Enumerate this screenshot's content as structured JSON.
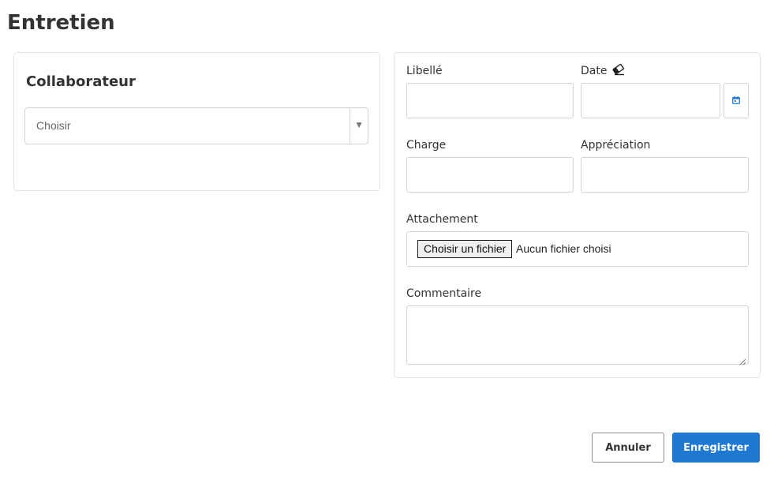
{
  "page": {
    "title": "Entretien"
  },
  "collaborateur": {
    "heading": "Collaborateur",
    "select": {
      "value": "Choisir"
    }
  },
  "form": {
    "libelle_label": "Libellé",
    "date_label": "Date",
    "charge_label": "Charge",
    "appreciation_label": "Appréciation",
    "attachement_label": "Attachement",
    "file_button_label": "Choisir un fichier",
    "file_status": "Aucun fichier choisi",
    "commentaire_label": "Commentaire"
  },
  "actions": {
    "cancel_label": "Annuler",
    "save_label": "Enregistrer"
  },
  "icons": {
    "eraser": "eraser-icon",
    "calendar": "calendar-icon",
    "select_arrow": "caret-down-icon"
  },
  "colors": {
    "accent": "#1f78d1",
    "calendar_icon": "#2a7fd4",
    "border": "#d4d4d4"
  }
}
